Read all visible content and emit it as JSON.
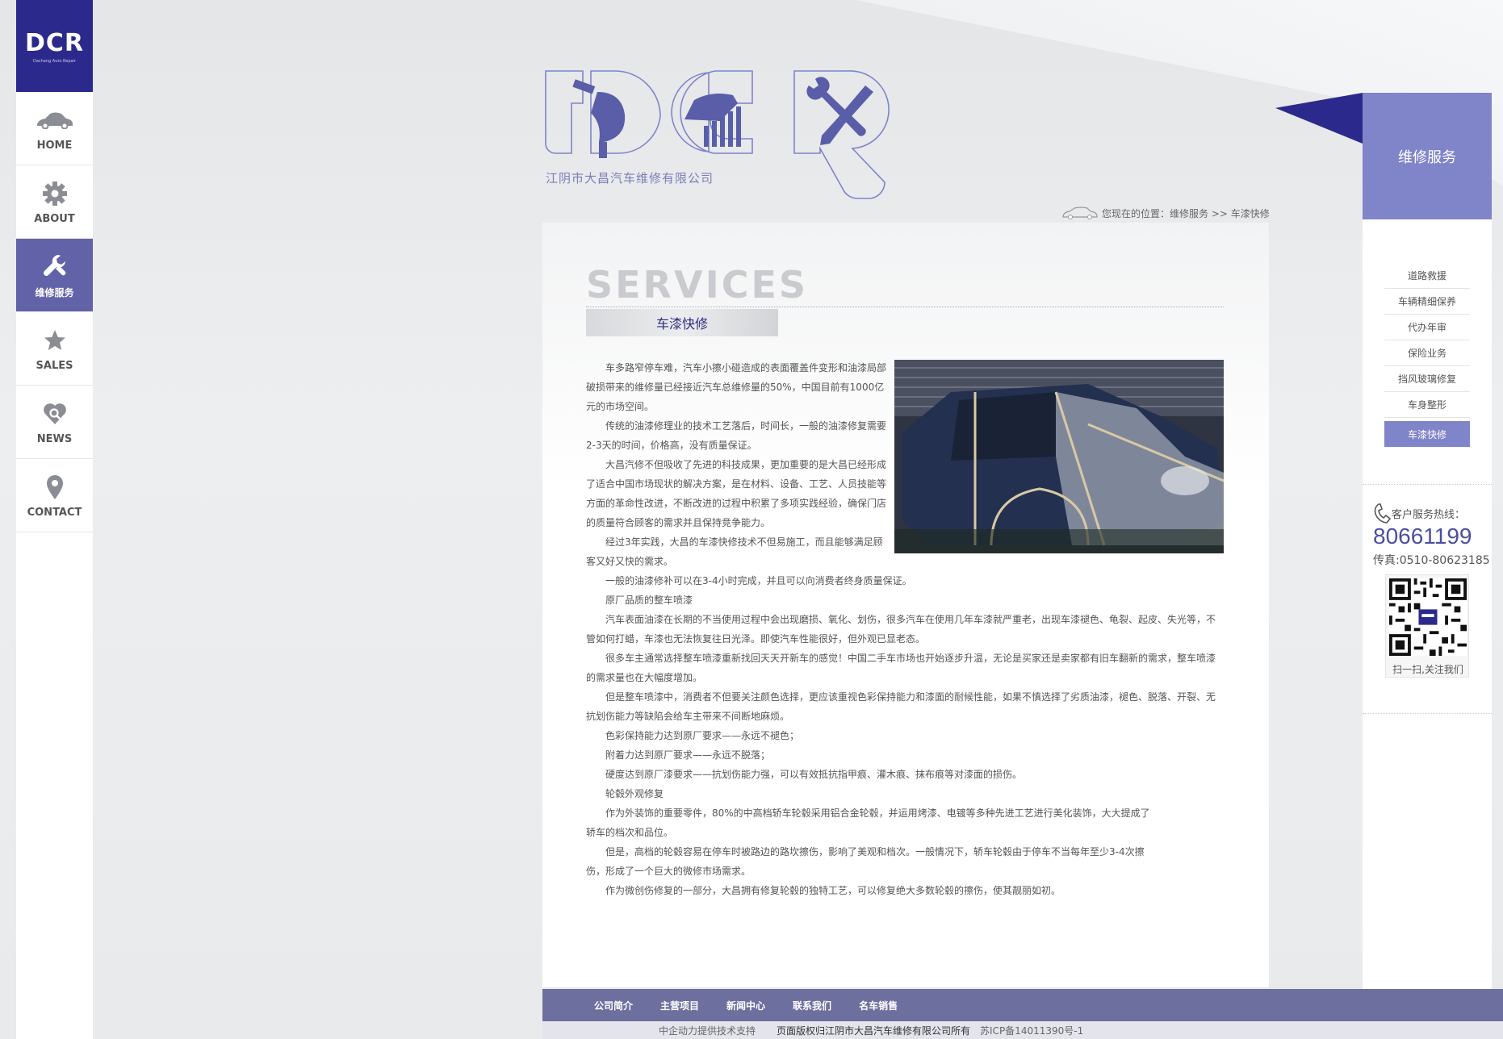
{
  "sidebar": {
    "logo_text": "DCR",
    "logo_sub": "Dachang Auto Repair",
    "items": [
      {
        "label": "HOME",
        "icon": "car-icon"
      },
      {
        "label": "ABOUT",
        "icon": "gear-icon"
      },
      {
        "label": "维修服务",
        "icon": "wrench-icon"
      },
      {
        "label": "SALES",
        "icon": "star-icon"
      },
      {
        "label": "NEWS",
        "icon": "heart-search-icon"
      },
      {
        "label": "CONTACT",
        "icon": "location-pin-icon"
      }
    ],
    "active_index": 2
  },
  "header": {
    "company_name": "江阴市大昌汽车维修有限公司",
    "breadcrumb": "您现在的位置：维修服务 >> 车漆快修"
  },
  "main": {
    "section_title": "SERVICES",
    "subtitle": "车漆快修",
    "paragraphs": [
      "车多路窄停车难，汽车小擦小碰造成的表面覆盖件变形和油漆局部破损带来的维修量已经接近汽车总维修量的50%，中国目前有1000亿元的市场空间。",
      "传统的油漆修理业的技术工艺落后，时间长，一般的油漆修复需要2-3天的时间，价格高，没有质量保证。",
      "大昌汽修不但吸收了先进的科技成果，更加重要的是大昌已经形成了适合中国市场现状的解决方案，是在材料、设备、工艺、人员技能等方面的革命性改进，不断改进的过程中积累了多项实践经验，确保门店的质量符合顾客的需求并且保持竞争能力。",
      "经过3年实践，大昌的车漆快修技术不但易施工，而且能够满足顾客又好又快的需求。",
      "一般的油漆修补可以在3-4小时完成，并且可以向消费者终身质量保证。",
      "原厂品质的整车喷漆",
      "汽车表面油漆在长期的不当使用过程中会出现磨损、氧化、划伤，很多汽车在使用几年车漆就严重老，出现车漆褪色、龟裂、起皮、失光等，不管如何打蜡，车漆也无法恢复往日光泽。即使汽车性能很好，但外观已显老态。",
      "很多车主通常选择整车喷漆重新找回天天开新车的感觉！中国二手车市场也开始逐步升温，无论是买家还是卖家都有旧车翻新的需求，整车喷漆的需求量也在大幅度增加。",
      "但是整车喷漆中，消费者不但要关注颜色选择，更应该重视色彩保持能力和漆面的耐候性能，如果不慎选择了劣质油漆，褪色、脱落、开裂、无抗划伤能力等缺陷会给车主带来不间断地麻烦。",
      "色彩保持能力达到原厂要求——永远不褪色；",
      "附着力达到原厂要求——永远不脱落；",
      "硬度达到原厂漆要求——抗划伤能力强，可以有效抵抗指甲痕、灌木痕、抹布痕等对漆面的损伤。",
      "轮毂外观修复",
      "作为外装饰的重要零件，80%的中高档轿车轮毂采用铝合金轮毂，并运用烤漆、电镀等多种先进工艺进行美化装饰，大大提成了轿车的档次和品位。",
      "但是，高档的轮毂容易在停车时被路边的路坎擦伤，影响了美观和档次。一般情况下，轿车轮毂由于停车不当每年至少3-4次擦伤，形成了一个巨大的微修市场需求。",
      "作为微创伤修复的一部分，大昌拥有修复轮毂的独特工艺，可以修复绝大多数轮毂的擦伤，使其靓丽如初。"
    ]
  },
  "right": {
    "title": "维修服务",
    "menu": [
      "道路救援",
      "车辆精细保养",
      "代办年审",
      "保险业务",
      "挡风玻璃修复",
      "车身整形",
      "车漆快修"
    ],
    "active_index": 6,
    "hotline_label": "客户服务热线：",
    "hotline": "80661199",
    "fax": "传真:0510-80623185",
    "qr_label": "扫一扫,关注我们"
  },
  "footer": {
    "links": [
      "公司简介",
      "主营项目",
      "新闻中心",
      "联系我们",
      "名车销售"
    ],
    "support": "中企动力提供技术支持",
    "copyright": "页面版权归江阴市大昌汽车维修有限公司所有",
    "icp": "苏ICP备14011390号-1"
  },
  "colors": {
    "brand_dark": "#2b2a8c",
    "accent": "#8084c8",
    "nav_active": "#6262a8",
    "footer": "#6d6f9f"
  }
}
